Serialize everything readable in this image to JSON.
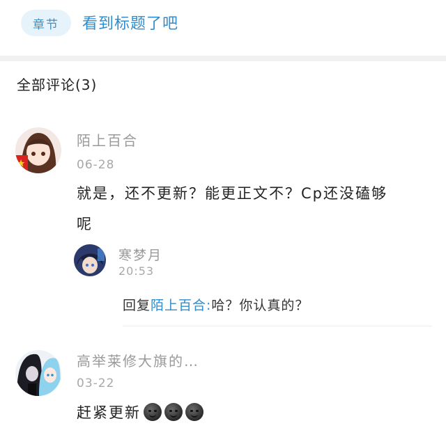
{
  "chapter": {
    "tag": "章节",
    "title": "看到标题了吧"
  },
  "comments_header": "全部评论(3)",
  "comments": [
    {
      "username": "陌上百合",
      "date": "06-28",
      "text_line1": "就是，还不更新？能更正文不？Cp还没磕够",
      "text_line2": "呢",
      "reply": {
        "username": "寒梦月",
        "time": "20:53",
        "prefix": "回复",
        "mention": "陌上百合:",
        "text": "哈？你认真的？"
      }
    },
    {
      "username": "高举莱修大旗的…",
      "date": "03-22",
      "text": "赶紧更新",
      "emojis": [
        "dark-face-emoji",
        "dark-face-emoji",
        "dark-face-emoji"
      ]
    }
  ]
}
